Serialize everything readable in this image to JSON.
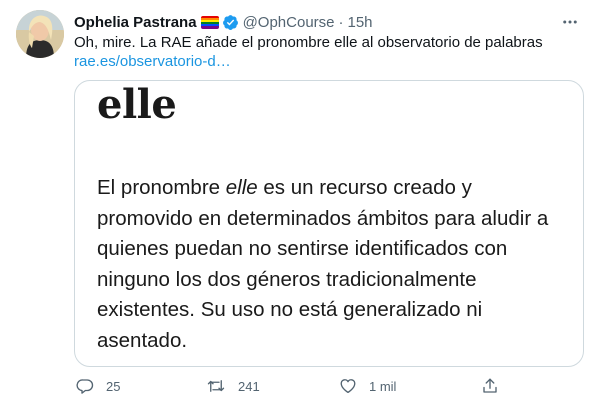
{
  "tweet": {
    "author_name": "Ophelia Pastrana",
    "handle": "@OphCourse",
    "separator": "·",
    "time": "15h",
    "text": "Oh, mire. La RAE añade el pronombre elle al observatorio de palabras",
    "link": "rae.es/observatorio-d…"
  },
  "card": {
    "title": "elle",
    "body": {
      "line1_a": "El pronombre ",
      "line1_em": "elle",
      "line1_b": " es un recurso creado y",
      "line2": "promovido en determinados ámbitos para aludir a",
      "line3": "quienes puedan no sentirse identificados con",
      "line4": "ninguno los dos géneros tradicionalmente",
      "line5": "existentes. Su uso no está generalizado ni",
      "line6": "asentado."
    }
  },
  "actions": {
    "reply_count": "25",
    "retweet_count": "241",
    "like_count": "1 mil"
  },
  "icons": {
    "flag": "rainbow-flag-icon",
    "verified": "verified-badge-icon",
    "more": "more-options-icon",
    "reply": "reply-icon",
    "retweet": "retweet-icon",
    "like": "heart-icon",
    "share": "share-icon"
  },
  "colors": {
    "verified_blue": "#1d9bf0",
    "link_blue": "#1b95e0",
    "muted_text": "#536471",
    "card_border": "#cfd9de",
    "flag_stripes": [
      "#e40303",
      "#ff8c00",
      "#ffed00",
      "#008026",
      "#004dff",
      "#750787"
    ]
  }
}
